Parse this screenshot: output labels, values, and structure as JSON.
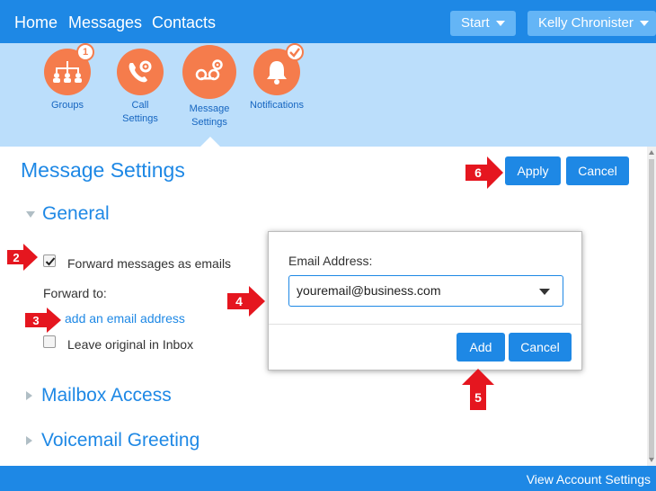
{
  "topbar": {
    "nav": [
      "Home",
      "Messages",
      "Contacts"
    ],
    "start_label": "Start",
    "user_label": "Kelly Chronister",
    "color": "#1e88e5"
  },
  "iconbar": {
    "items": [
      {
        "label": "Groups",
        "icon": "groups-icon",
        "badge": "1"
      },
      {
        "label": "Call\nSettings",
        "icon": "call-settings-icon"
      },
      {
        "label": "Message\nSettings",
        "icon": "voicemail-settings-icon",
        "active": true
      },
      {
        "label": "Notifications",
        "icon": "notification-bell-icon",
        "badge_icon": "check-icon"
      }
    ],
    "accent": "#f57c4c"
  },
  "main": {
    "title": "Message Settings",
    "apply_label": "Apply",
    "cancel_label": "Cancel",
    "sections": {
      "general": "General",
      "mailbox": "Mailbox Access",
      "voicemail": "Voicemail Greeting"
    },
    "forward_checkbox": {
      "label": "Forward messages as emails",
      "checked": true
    },
    "forward_to_label": "Forward to:",
    "add_email_link": "add an email address",
    "leave_original": {
      "label": "Leave original in Inbox",
      "checked": false
    }
  },
  "dialog": {
    "label": "Email Address:",
    "value": "youremail@business.com",
    "add_label": "Add",
    "cancel_label": "Cancel"
  },
  "steps": [
    "2",
    "3",
    "4",
    "5",
    "6"
  ],
  "footer": {
    "link": "View Account Settings"
  },
  "colors": {
    "primary": "#1e88e5",
    "band": "#bbdefb",
    "callout": "#e5161f"
  }
}
